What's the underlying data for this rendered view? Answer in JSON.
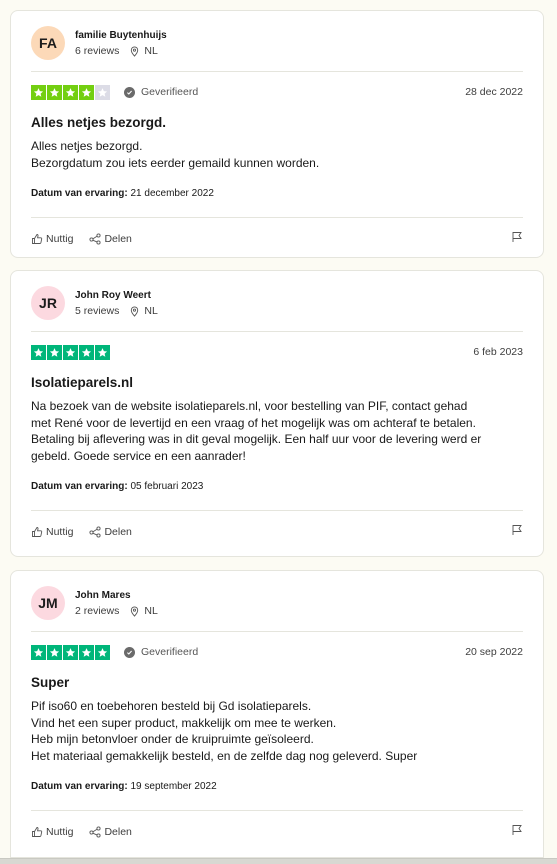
{
  "colors": {
    "star_green": "#00b67a",
    "star_lime": "#73cf11",
    "star_empty": "#dcdce6",
    "avatar_peach": "#fcd9b8",
    "avatar_pink": "#fcd9e0"
  },
  "reviews": [
    {
      "initials": "FA",
      "avatar_color": "#fcd9b8",
      "name": "familie Buytenhuijs",
      "reviews_count": "6 reviews",
      "country": "NL",
      "stars": 4,
      "star_color": "#73cf11",
      "verified": true,
      "verified_label": "Geverifieerd",
      "date": "28 dec 2022",
      "title": "Alles netjes bezorgd.",
      "body": [
        "Alles netjes bezorgd.",
        "Bezorgdatum zou iets eerder gemaild kunnen worden."
      ],
      "experience_label": "Datum van ervaring:",
      "experience_date": "21 december 2022",
      "useful_label": "Nuttig",
      "share_label": "Delen"
    },
    {
      "initials": "JR",
      "avatar_color": "#fcd9e0",
      "name": "John Roy Weert",
      "reviews_count": "5 reviews",
      "country": "NL",
      "stars": 5,
      "star_color": "#00b67a",
      "verified": false,
      "verified_label": "",
      "date": "6 feb 2023",
      "title": "Isolatieparels.nl",
      "body": [
        "Na bezoek van de website isolatieparels.nl, voor bestelling van PIF, contact gehad",
        "met René voor de levertijd en een vraag of het mogelijk was om achteraf te betalen.",
        "Betaling bij aflevering was in dit geval mogelijk. Een half uur voor de levering werd er",
        "gebeld. Goede service en een aanrader!"
      ],
      "experience_label": "Datum van ervaring:",
      "experience_date": "05 februari 2023",
      "useful_label": "Nuttig",
      "share_label": "Delen"
    },
    {
      "initials": "JM",
      "avatar_color": "#fcd9e0",
      "name": "John Mares",
      "reviews_count": "2 reviews",
      "country": "NL",
      "stars": 5,
      "star_color": "#00b67a",
      "verified": true,
      "verified_label": "Geverifieerd",
      "date": "20 sep 2022",
      "title": "Super",
      "body": [
        "Pif iso60 en toebehoren besteld bij Gd isolatieparels.",
        "Vind het een super product, makkelijk om mee te werken.",
        "Heb mijn betonvloer onder de kruipruimte geïsoleerd.",
        "Het materiaal gemakkelijk besteld, en de zelfde dag nog geleverd. Super"
      ],
      "experience_label": "Datum van ervaring:",
      "experience_date": "19 september 2022",
      "useful_label": "Nuttig",
      "share_label": "Delen"
    }
  ]
}
